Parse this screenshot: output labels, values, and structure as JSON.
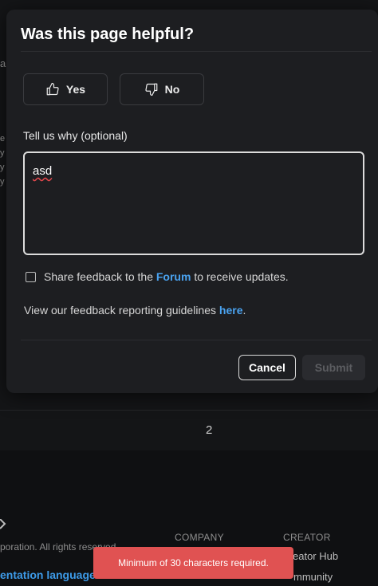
{
  "modal": {
    "title": "Was this page helpful?",
    "yes_label": "Yes",
    "no_label": "No",
    "why_label": "Tell us why (optional)",
    "textarea_value": "asd",
    "share_prefix": "Share feedback to the ",
    "share_link": "Forum",
    "share_suffix": " to receive updates.",
    "guidelines_prefix": "View our feedback reporting guidelines ",
    "guidelines_link": "here",
    "guidelines_suffix": ".",
    "cancel_label": "Cancel",
    "submit_label": "Submit"
  },
  "background": {
    "fragment_1": "a",
    "fragment_2": "e",
    "fragment_3": "y",
    "fragment_4": "y",
    "fragment_5": "y",
    "page_number": "2"
  },
  "footer": {
    "copyright": "poration. All rights reserved",
    "language_link": "entation language",
    "company_heading": "COMPANY",
    "creator_heading": "CREATOR",
    "creator_item_1": "eator Hub",
    "creator_item_2": "mmunity"
  },
  "toast": {
    "message": "Minimum of 30 characters required."
  },
  "colors": {
    "accent_link": "#4aa3f0",
    "toast_bg": "#e05252",
    "modal_bg": "#1d1e21"
  }
}
